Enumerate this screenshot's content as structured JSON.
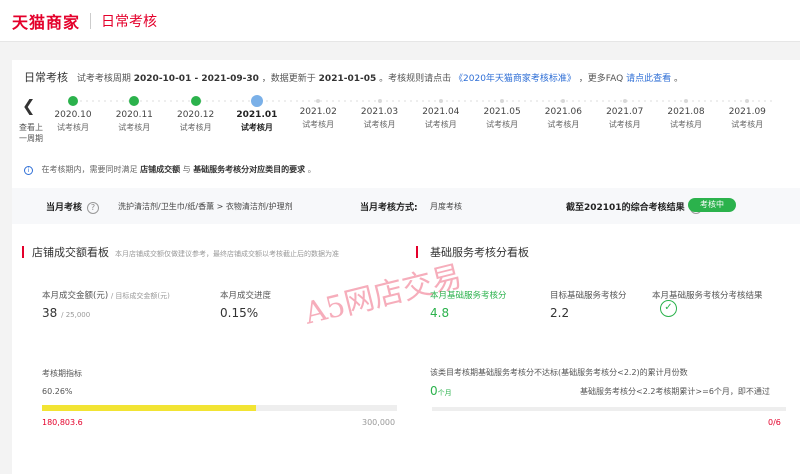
{
  "header": {
    "logo": "天猫商家",
    "title": "日常考核"
  },
  "summary": {
    "title": "日常考核",
    "period_label": "试考考核周期",
    "period": "2020-10-01 - 2021-09-30",
    "update_label": "，数据更新于",
    "update": "2021-01-05",
    "rule_text": "。考核规则请点击",
    "rule_link": "《2020年天猫商家考核标准》",
    "faq_text": "，更多FAQ",
    "faq_link": "请点此查看",
    "end": "。"
  },
  "timeline": {
    "prev_label": "查看上一周期",
    "months": [
      {
        "month": "2020.10",
        "sub": "试考核月",
        "status": "pass"
      },
      {
        "month": "2020.11",
        "sub": "试考核月",
        "status": "pass"
      },
      {
        "month": "2020.12",
        "sub": "试考核月",
        "status": "pass"
      },
      {
        "month": "2021.01",
        "sub": "试考核月",
        "status": "current"
      },
      {
        "month": "2021.02",
        "sub": "试考核月",
        "status": "future"
      },
      {
        "month": "2021.03",
        "sub": "试考核月",
        "status": "future"
      },
      {
        "month": "2021.04",
        "sub": "试考核月",
        "status": "future"
      },
      {
        "month": "2021.05",
        "sub": "试考核月",
        "status": "future"
      },
      {
        "month": "2021.06",
        "sub": "试考核月",
        "status": "future"
      },
      {
        "month": "2021.07",
        "sub": "试考核月",
        "status": "future"
      },
      {
        "month": "2021.08",
        "sub": "试考核月",
        "status": "future"
      },
      {
        "month": "2021.09",
        "sub": "试考核月",
        "status": "future"
      }
    ]
  },
  "notice": {
    "pre": "在考核期内，需要同时满足",
    "b1": "店铺成交额",
    "mid": "与",
    "b2": "基础服务考核分对应类目的要求",
    "end": "。"
  },
  "strip": {
    "category_label": "当月考核",
    "category_value": "洗护清洁剂/卫生巾/纸/香薰 > 衣物清洁剂/护理剂",
    "method_label": "当月考核方式:",
    "method_value": "月度考核",
    "result_label": "截至202101的综合考核结果",
    "result_badge": "考核中"
  },
  "left_panel": {
    "title": "店铺成交额看板",
    "subtitle": "本月店铺成交额仅做建议参考，最终店铺成交额以考核截止后的数据为准",
    "gmv_label": "本月成交金额(元)",
    "gmv_target_label": "/ 目标成交金额(元)",
    "gmv_value": "38",
    "gmv_target": "/ 25,000",
    "progress_label": "本月成交进度",
    "progress_value": "0.15%",
    "period_index_label": "考核期指标",
    "period_index_pct": "60.26%",
    "period_progress": 0.6026,
    "period_current": "180,803.6",
    "period_target": "300,000"
  },
  "right_panel": {
    "title": "基础服务考核分看板",
    "score_label": "本月基础服务考核分",
    "score_value": "4.8",
    "target_label": "目标基础服务考核分",
    "target_value": "2.2",
    "result_label": "本月基础服务考核分考核结果",
    "fail_note": "该类目考核期基础服务考核分不达标(基础服务考核分<2.2)的累计月份数",
    "months_value": "0",
    "months_unit": "个月",
    "rule_text": "基础服务考核分<2.2考核期累计>=6个月，即不通过",
    "fraction": "0/6",
    "fail_progress": 0
  },
  "colors": {
    "brand": "#e4002b",
    "pass": "#2bb24c",
    "link": "#2f6fd6",
    "progress": "#f2e433"
  },
  "watermark": "A5网店交易"
}
